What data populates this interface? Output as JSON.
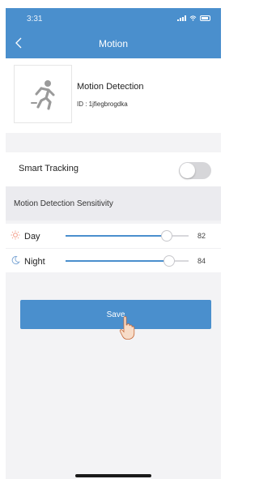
{
  "status_bar": {
    "time": "3:31",
    "icons": [
      "signal-icon",
      "wifi-icon",
      "battery-icon"
    ]
  },
  "header": {
    "title": "Motion",
    "back_icon": "chevron-left-icon",
    "bg_color": "#4a8fcd"
  },
  "device": {
    "icon": "running-person-icon",
    "title": "Motion Detection",
    "id_text": "ID : 1jfiegbrogdka"
  },
  "smart_tracking": {
    "label": "Smart Tracking",
    "enabled": false
  },
  "sensitivity": {
    "section_label": "Motion Detection Sensitivity",
    "day": {
      "label": "Day",
      "icon": "sun-icon",
      "value": "82"
    },
    "night": {
      "label": "Night",
      "icon": "moon-icon",
      "value": "84"
    }
  },
  "actions": {
    "save_label": "Save"
  }
}
